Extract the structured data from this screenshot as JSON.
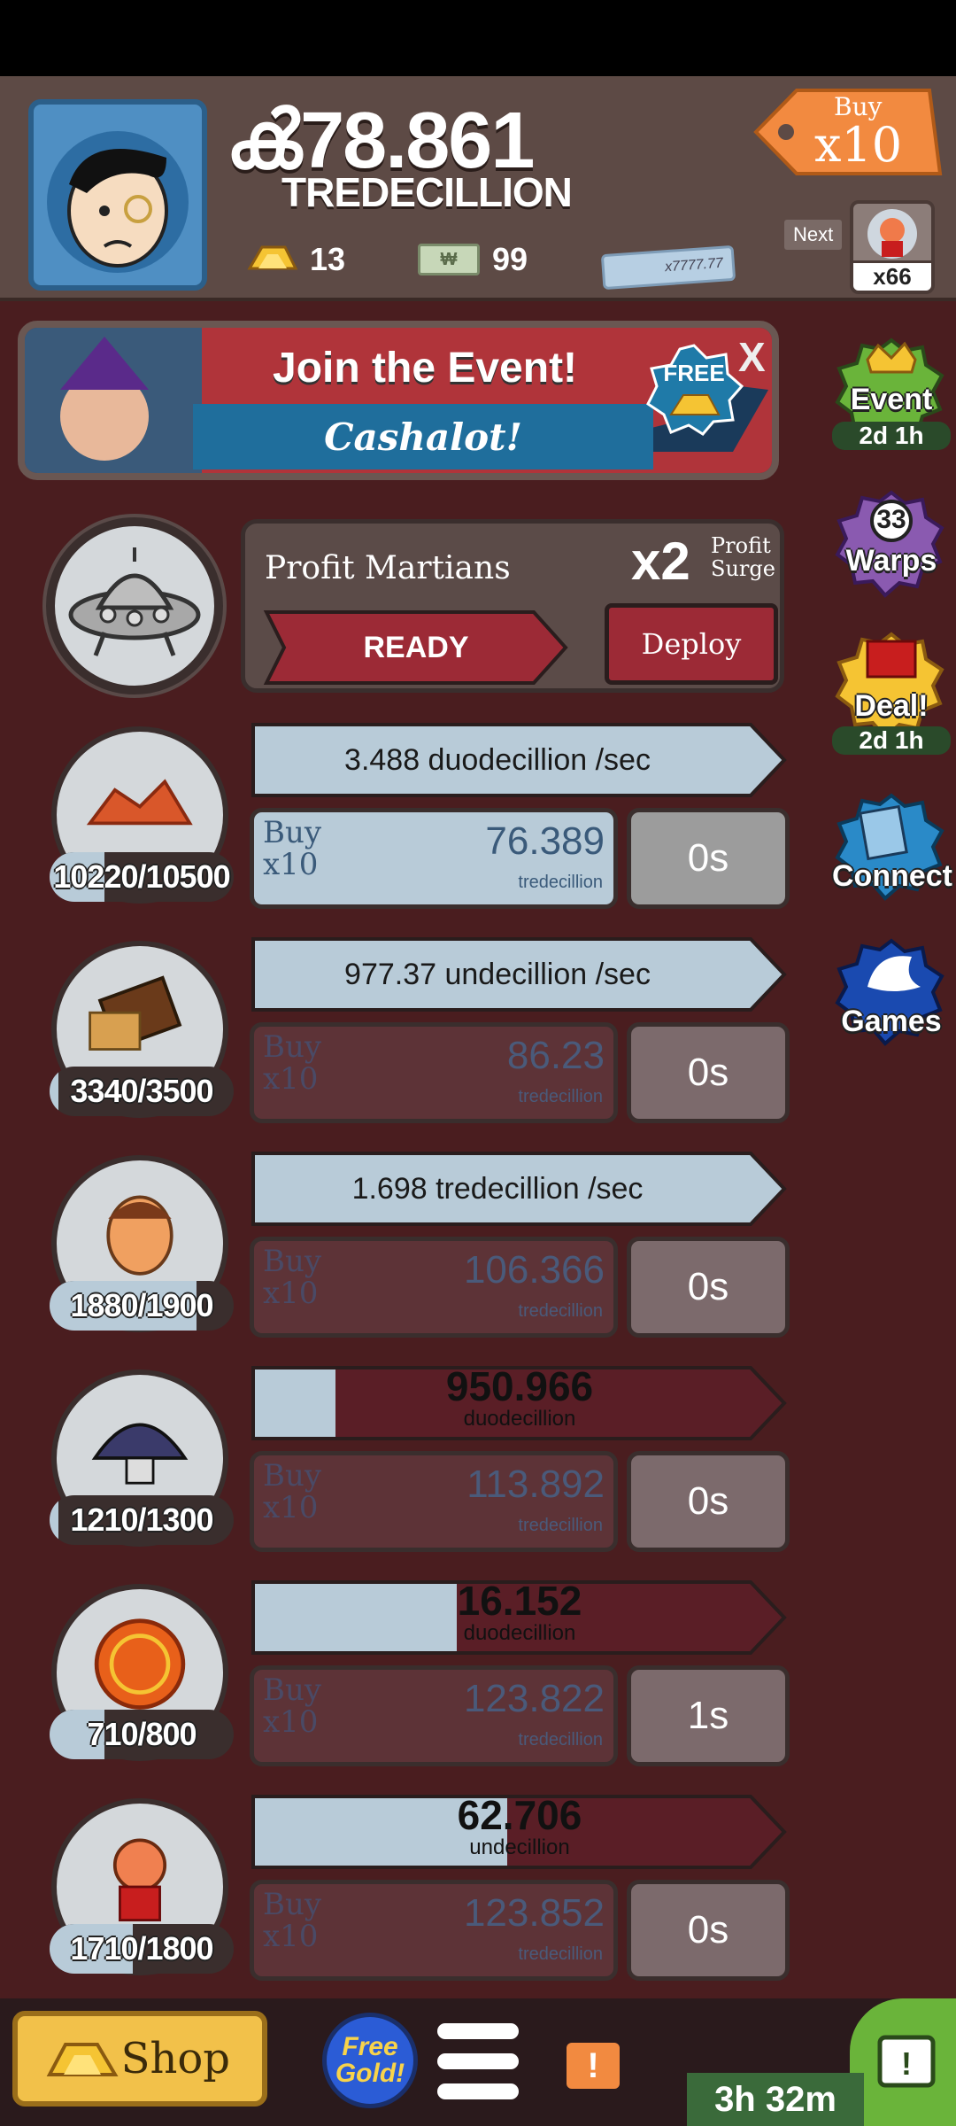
{
  "header": {
    "money_value": "ൿ78.861",
    "money_unit": "TREDECILLION",
    "gold_count": "13",
    "megabucks_count": "99",
    "big_bill_label": "x7777.77",
    "buy_tag_top": "Buy",
    "buy_tag_mult": "x10",
    "next_label": "Next",
    "next_count": "x66"
  },
  "event_banner": {
    "title": "Join the Event!",
    "subtitle": "Cashalot!",
    "free_label": "FREE",
    "close_label": "X"
  },
  "side": {
    "event_label": "Event",
    "event_timer": "2d 1h",
    "warps_count": "33",
    "warps_label": "Warps",
    "deal_label": "Deal!",
    "deal_timer": "2d 1h",
    "connect_label": "Connect",
    "games_label": "Games"
  },
  "manager": {
    "name": "Profit Martians",
    "multiplier": "x2",
    "multiplier_sub1": "Profit",
    "multiplier_sub2": "Surge",
    "ready_label": "READY",
    "deploy_label": "Deploy"
  },
  "businesses": [
    {
      "count": "10220/10500",
      "progress": 0.3,
      "rate": "3.488 duodecillion /sec",
      "buy_a": "Buy",
      "buy_b": "x10",
      "price": "76.389",
      "unit": "tredecillion",
      "time": "0s",
      "dim": false
    },
    {
      "count": "3340/3500",
      "progress": 0.05,
      "rate": "977.37 undecillion /sec",
      "buy_a": "Buy",
      "buy_b": "x10",
      "price": "86.23",
      "unit": "tredecillion",
      "time": "0s",
      "dim": true
    },
    {
      "count": "1880/1900",
      "progress": 0.8,
      "rate": "1.698 tredecillion /sec",
      "buy_a": "Buy",
      "buy_b": "x10",
      "price": "106.366",
      "unit": "tredecillion",
      "time": "0s",
      "dim": true
    },
    {
      "count": "1210/1300",
      "progress": 0.05,
      "bar_value": "950.966",
      "bar_unit": "duodecillion",
      "bar_fill": 0.16,
      "buy_a": "Buy",
      "buy_b": "x10",
      "price": "113.892",
      "unit": "tredecillion",
      "time": "0s",
      "dim": true
    },
    {
      "count": "710/800",
      "progress": 0.3,
      "bar_value": "16.152",
      "bar_unit": "duodecillion",
      "bar_fill": 0.4,
      "buy_a": "Buy",
      "buy_b": "x10",
      "price": "123.822",
      "unit": "tredecillion",
      "time": "1s",
      "dim": true
    },
    {
      "count": "1710/1800",
      "progress": 0.45,
      "bar_value": "62.706",
      "bar_unit": "undecillion",
      "bar_fill": 0.5,
      "buy_a": "Buy",
      "buy_b": "x10",
      "price": "123.852",
      "unit": "tredecillion",
      "time": "0s",
      "dim": true
    }
  ],
  "bottom": {
    "shop_label": "Shop",
    "free_gold_label": "Free Gold!",
    "alert_label": "!",
    "timer_label": "3h 32m"
  },
  "colors": {
    "background": "#4a1d1f",
    "bar_light": "#b8cbd8",
    "bar_dark": "#5a1e26",
    "accent_gold": "#f2c14a"
  }
}
